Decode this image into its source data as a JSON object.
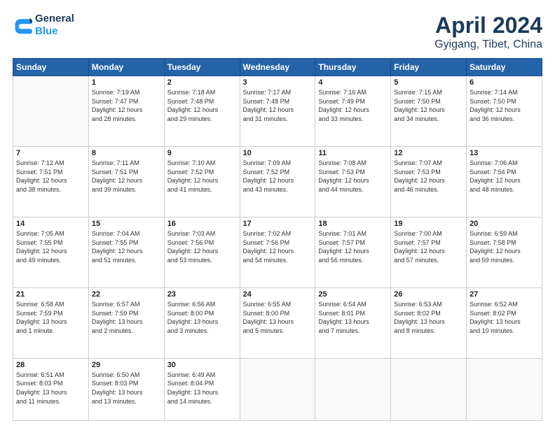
{
  "header": {
    "logo_line1": "General",
    "logo_line2": "Blue",
    "title": "April 2024",
    "subtitle": "Gyigang, Tibet, China"
  },
  "columns": [
    "Sunday",
    "Monday",
    "Tuesday",
    "Wednesday",
    "Thursday",
    "Friday",
    "Saturday"
  ],
  "weeks": [
    [
      {
        "day": "",
        "info": ""
      },
      {
        "day": "1",
        "info": "Sunrise: 7:19 AM\nSunset: 7:47 PM\nDaylight: 12 hours\nand 28 minutes."
      },
      {
        "day": "2",
        "info": "Sunrise: 7:18 AM\nSunset: 7:48 PM\nDaylight: 12 hours\nand 29 minutes."
      },
      {
        "day": "3",
        "info": "Sunrise: 7:17 AM\nSunset: 7:48 PM\nDaylight: 12 hours\nand 31 minutes."
      },
      {
        "day": "4",
        "info": "Sunrise: 7:16 AM\nSunset: 7:49 PM\nDaylight: 12 hours\nand 33 minutes."
      },
      {
        "day": "5",
        "info": "Sunrise: 7:15 AM\nSunset: 7:50 PM\nDaylight: 12 hours\nand 34 minutes."
      },
      {
        "day": "6",
        "info": "Sunrise: 7:14 AM\nSunset: 7:50 PM\nDaylight: 12 hours\nand 36 minutes."
      }
    ],
    [
      {
        "day": "7",
        "info": "Sunrise: 7:12 AM\nSunset: 7:51 PM\nDaylight: 12 hours\nand 38 minutes."
      },
      {
        "day": "8",
        "info": "Sunrise: 7:11 AM\nSunset: 7:51 PM\nDaylight: 12 hours\nand 39 minutes."
      },
      {
        "day": "9",
        "info": "Sunrise: 7:10 AM\nSunset: 7:52 PM\nDaylight: 12 hours\nand 41 minutes."
      },
      {
        "day": "10",
        "info": "Sunrise: 7:09 AM\nSunset: 7:52 PM\nDaylight: 12 hours\nand 43 minutes."
      },
      {
        "day": "11",
        "info": "Sunrise: 7:08 AM\nSunset: 7:53 PM\nDaylight: 12 hours\nand 44 minutes."
      },
      {
        "day": "12",
        "info": "Sunrise: 7:07 AM\nSunset: 7:53 PM\nDaylight: 12 hours\nand 46 minutes."
      },
      {
        "day": "13",
        "info": "Sunrise: 7:06 AM\nSunset: 7:54 PM\nDaylight: 12 hours\nand 48 minutes."
      }
    ],
    [
      {
        "day": "14",
        "info": "Sunrise: 7:05 AM\nSunset: 7:55 PM\nDaylight: 12 hours\nand 49 minutes."
      },
      {
        "day": "15",
        "info": "Sunrise: 7:04 AM\nSunset: 7:55 PM\nDaylight: 12 hours\nand 51 minutes."
      },
      {
        "day": "16",
        "info": "Sunrise: 7:03 AM\nSunset: 7:56 PM\nDaylight: 12 hours\nand 53 minutes."
      },
      {
        "day": "17",
        "info": "Sunrise: 7:02 AM\nSunset: 7:56 PM\nDaylight: 12 hours\nand 54 minutes."
      },
      {
        "day": "18",
        "info": "Sunrise: 7:01 AM\nSunset: 7:57 PM\nDaylight: 12 hours\nand 56 minutes."
      },
      {
        "day": "19",
        "info": "Sunrise: 7:00 AM\nSunset: 7:57 PM\nDaylight: 12 hours\nand 57 minutes."
      },
      {
        "day": "20",
        "info": "Sunrise: 6:59 AM\nSunset: 7:58 PM\nDaylight: 12 hours\nand 59 minutes."
      }
    ],
    [
      {
        "day": "21",
        "info": "Sunrise: 6:58 AM\nSunset: 7:59 PM\nDaylight: 13 hours\nand 1 minute."
      },
      {
        "day": "22",
        "info": "Sunrise: 6:57 AM\nSunset: 7:59 PM\nDaylight: 13 hours\nand 2 minutes."
      },
      {
        "day": "23",
        "info": "Sunrise: 6:56 AM\nSunset: 8:00 PM\nDaylight: 13 hours\nand 3 minutes."
      },
      {
        "day": "24",
        "info": "Sunrise: 6:55 AM\nSunset: 8:00 PM\nDaylight: 13 hours\nand 5 minutes."
      },
      {
        "day": "25",
        "info": "Sunrise: 6:54 AM\nSunset: 8:01 PM\nDaylight: 13 hours\nand 7 minutes."
      },
      {
        "day": "26",
        "info": "Sunrise: 6:53 AM\nSunset: 8:02 PM\nDaylight: 13 hours\nand 8 minutes."
      },
      {
        "day": "27",
        "info": "Sunrise: 6:52 AM\nSunset: 8:02 PM\nDaylight: 13 hours\nand 10 minutes."
      }
    ],
    [
      {
        "day": "28",
        "info": "Sunrise: 6:51 AM\nSunset: 8:03 PM\nDaylight: 13 hours\nand 11 minutes."
      },
      {
        "day": "29",
        "info": "Sunrise: 6:50 AM\nSunset: 8:03 PM\nDaylight: 13 hours\nand 13 minutes."
      },
      {
        "day": "30",
        "info": "Sunrise: 6:49 AM\nSunset: 8:04 PM\nDaylight: 13 hours\nand 14 minutes."
      },
      {
        "day": "",
        "info": ""
      },
      {
        "day": "",
        "info": ""
      },
      {
        "day": "",
        "info": ""
      },
      {
        "day": "",
        "info": ""
      }
    ]
  ]
}
